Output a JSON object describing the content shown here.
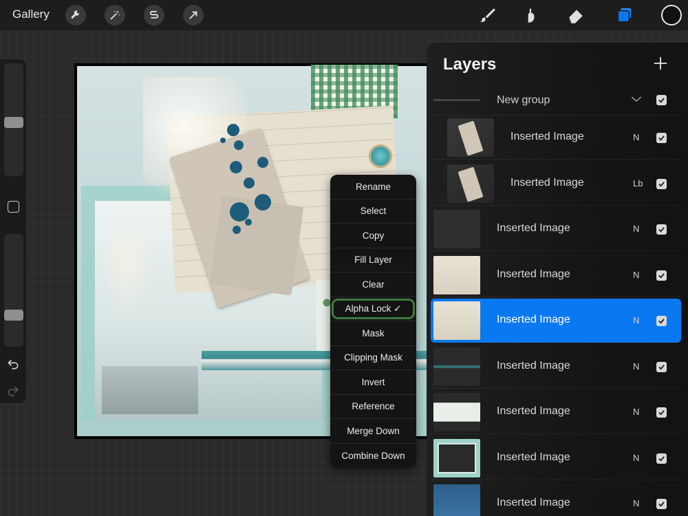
{
  "topbar": {
    "gallery_label": "Gallery",
    "left_tools": [
      "wrench-icon",
      "magic-wand-icon",
      "selection-s-icon",
      "transform-arrow-icon"
    ],
    "right_tools": [
      "brush-icon",
      "smudge-icon",
      "eraser-icon",
      "layers-icon"
    ],
    "accent_color": "#0a78f0"
  },
  "context_menu": {
    "items": [
      "Rename",
      "Select",
      "Copy",
      "Fill Layer",
      "Clear",
      "Alpha Lock ✓",
      "Mask",
      "Clipping Mask",
      "Invert",
      "Reference",
      "Merge Down",
      "Combine Down"
    ],
    "highlighted_item": "Alpha Lock ✓",
    "highlight_color": "#3f7a3f"
  },
  "layers": {
    "title": "Layers",
    "group": {
      "name": "New group"
    },
    "rows": [
      {
        "name": "Inserted Image",
        "blend": "N",
        "indent": true,
        "selected": false
      },
      {
        "name": "Inserted Image",
        "blend": "Lb",
        "indent": true,
        "selected": false
      },
      {
        "name": "Inserted Image",
        "blend": "N",
        "indent": false,
        "selected": false
      },
      {
        "name": "Inserted Image",
        "blend": "N",
        "indent": false,
        "selected": false
      },
      {
        "name": "Inserted Image",
        "blend": "N",
        "indent": false,
        "selected": true
      },
      {
        "name": "Inserted Image",
        "blend": "N",
        "indent": false,
        "selected": false
      },
      {
        "name": "Inserted Image",
        "blend": "N",
        "indent": false,
        "selected": false
      },
      {
        "name": "Inserted Image",
        "blend": "N",
        "indent": false,
        "selected": false
      },
      {
        "name": "Inserted Image",
        "blend": "N",
        "indent": false,
        "selected": false
      }
    ]
  }
}
